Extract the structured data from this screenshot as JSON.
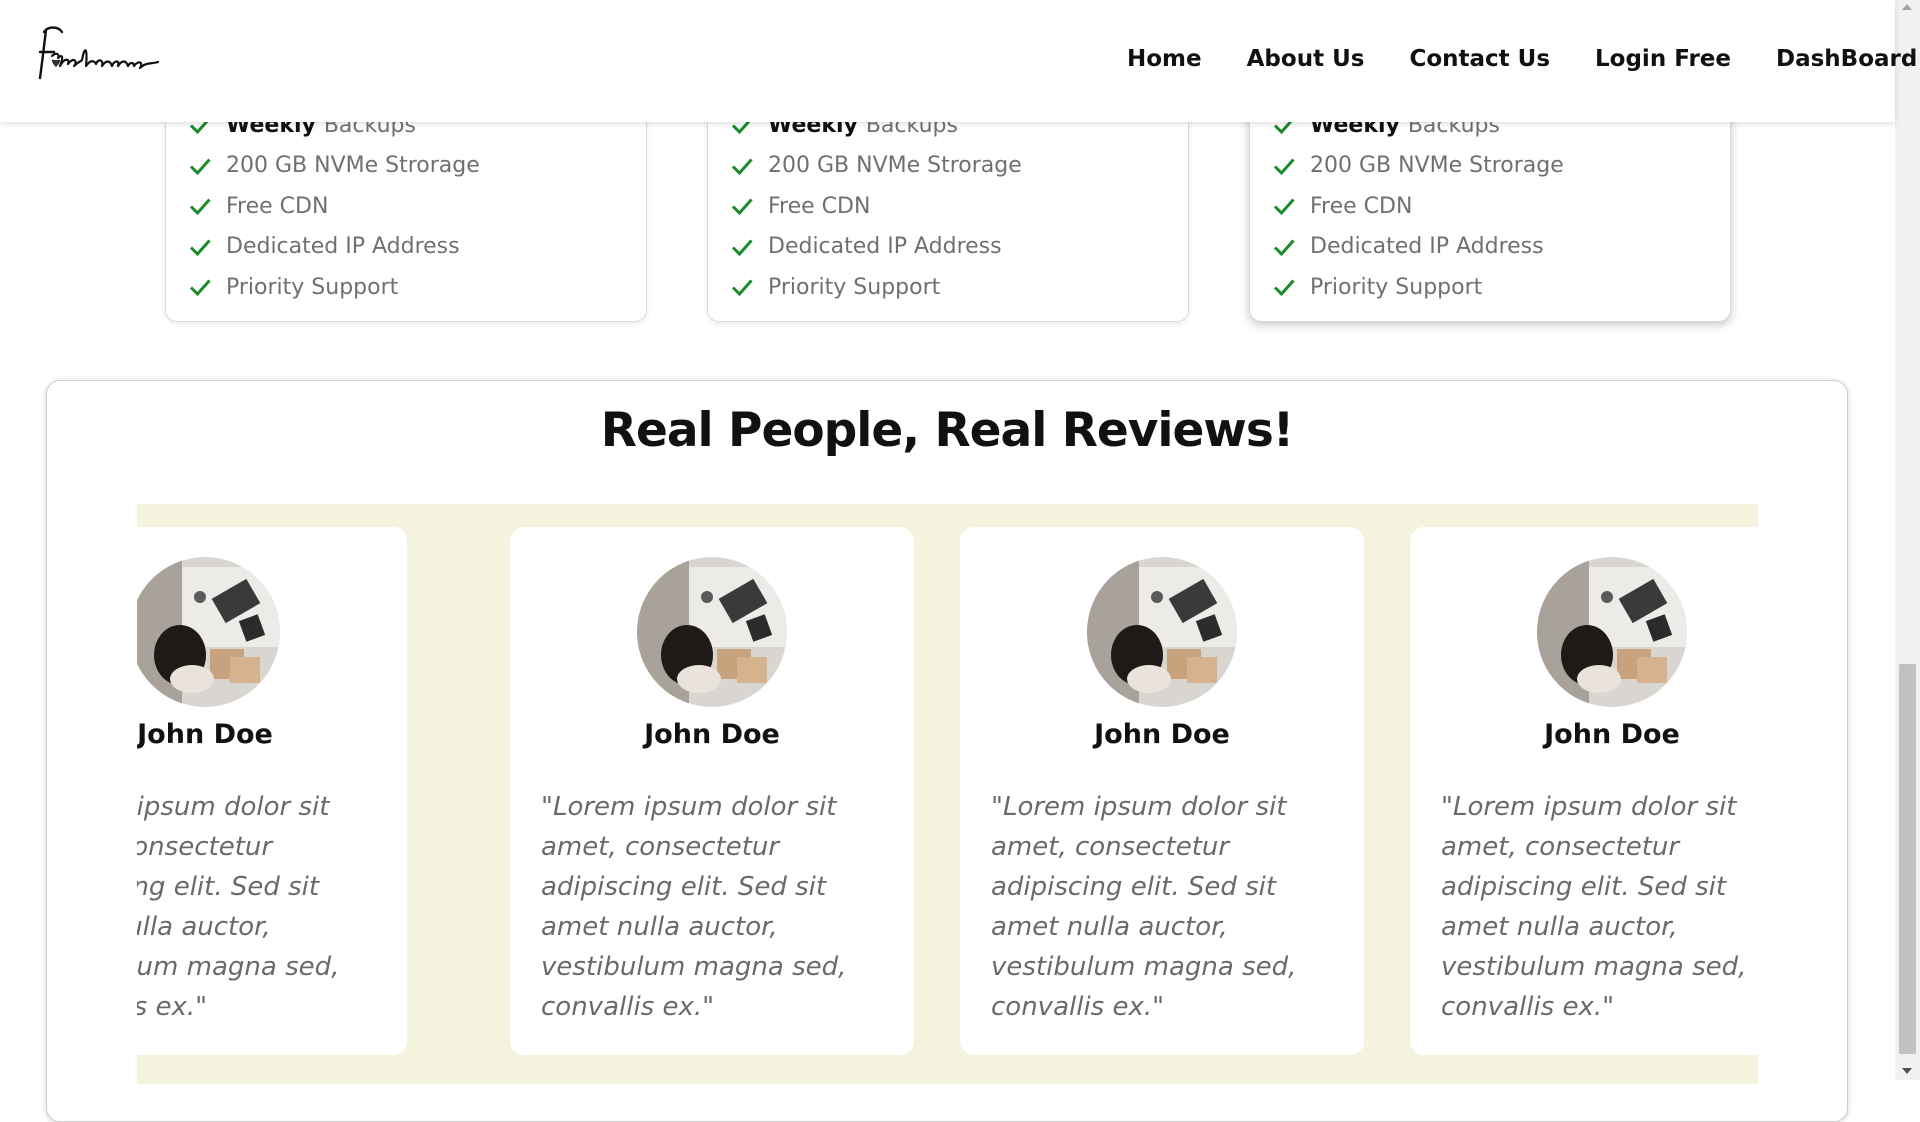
{
  "header": {
    "logo_text": "Freelance",
    "nav": [
      "Home",
      "About Us",
      "Contact Us",
      "Login Free",
      "DashBoard"
    ]
  },
  "plans": [
    {
      "features": [
        {
          "strong": "Weekly",
          "text": "Backups"
        },
        {
          "text": "200 GB NVMe Strorage"
        },
        {
          "text": "Free CDN"
        },
        {
          "text": "Dedicated IP Address"
        },
        {
          "text": "Priority Support"
        }
      ]
    },
    {
      "features": [
        {
          "strong": "Weekly",
          "text": "Backups"
        },
        {
          "text": "200 GB NVMe Strorage"
        },
        {
          "text": "Free CDN"
        },
        {
          "text": "Dedicated IP Address"
        },
        {
          "text": "Priority Support"
        }
      ]
    },
    {
      "features": [
        {
          "strong": "Weekly",
          "text": "Backups"
        },
        {
          "text": "200 GB NVMe Strorage"
        },
        {
          "text": "Free CDN"
        },
        {
          "text": "Dedicated IP Address"
        },
        {
          "text": "Priority Support"
        }
      ]
    }
  ],
  "reviews": {
    "title": "Real People, Real Reviews!",
    "items": [
      {
        "name": "John Doe",
        "text": "\"Lorem ipsum dolor sit amet, consectetur adipiscing elit. Sed sit amet nulla auctor, vestibulum magna sed, convallis ex.\""
      },
      {
        "name": "John Doe",
        "text": "\"Lorem ipsum dolor sit amet, consectetur adipiscing elit. Sed sit amet nulla auctor, vestibulum magna sed, convallis ex.\""
      },
      {
        "name": "John Doe",
        "text": "\"Lorem ipsum dolor sit amet, consectetur adipiscing elit. Sed sit amet nulla auctor, vestibulum magna sed, convallis ex.\""
      },
      {
        "name": "John Doe",
        "text": "\"Lorem ipsum dolor sit amet, consectetur adipiscing elit. Sed sit amet nulla auctor, vestibulum magna sed, convallis ex.\""
      }
    ]
  },
  "colors": {
    "check": "#1a8a2a",
    "review_track": "#f4f4de",
    "feature_text": "#707070"
  }
}
